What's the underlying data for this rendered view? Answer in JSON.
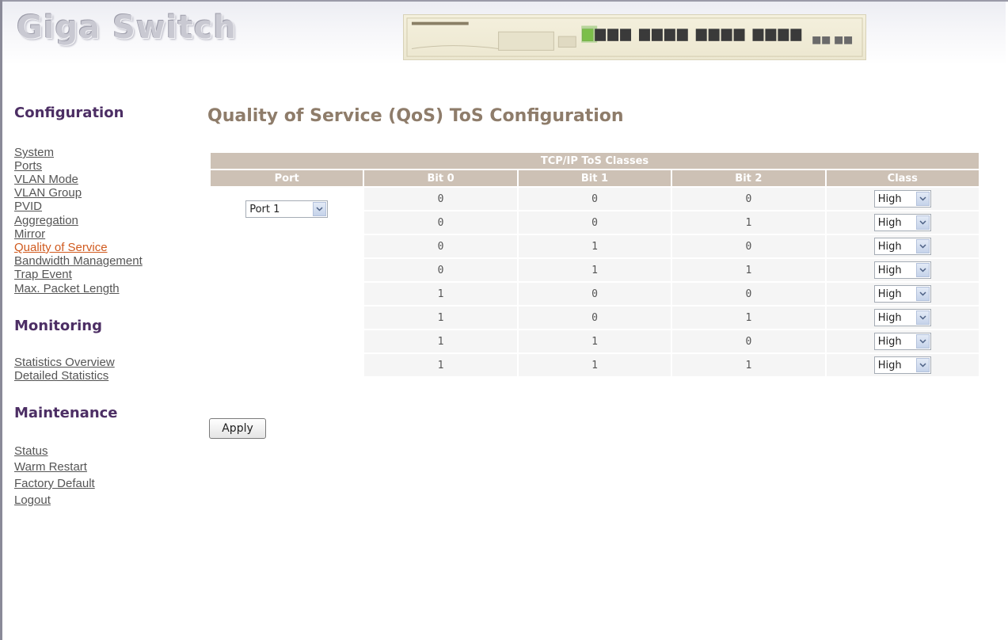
{
  "header": {
    "logo_text": "Giga Switch"
  },
  "sidebar": {
    "configuration": {
      "heading": "Configuration",
      "items": [
        {
          "label": "System"
        },
        {
          "label": "Ports"
        },
        {
          "label": "VLAN Mode"
        },
        {
          "label": "VLAN Group"
        },
        {
          "label": "PVID"
        },
        {
          "label": "Aggregation"
        },
        {
          "label": "Mirror"
        },
        {
          "label": "Quality of Service",
          "active": true
        },
        {
          "label": "Bandwidth Management"
        },
        {
          "label": "Trap Event"
        },
        {
          "label": "Max. Packet Length"
        }
      ]
    },
    "monitoring": {
      "heading": "Monitoring",
      "items": [
        {
          "label": "Statistics Overview"
        },
        {
          "label": "Detailed Statistics"
        }
      ]
    },
    "maintenance": {
      "heading": "Maintenance",
      "items": [
        {
          "label": "Status"
        },
        {
          "label": "Warm Restart"
        },
        {
          "label": "Factory Default"
        },
        {
          "label": "Logout"
        }
      ]
    }
  },
  "main": {
    "title": "Quality of Service (QoS) ToS Configuration",
    "table": {
      "caption": "TCP/IP ToS Classes",
      "columns": [
        "Port",
        "Bit 0",
        "Bit 1",
        "Bit 2",
        "Class"
      ],
      "port_value": "Port 1",
      "rows": [
        {
          "bit0": "0",
          "bit1": "0",
          "bit2": "0",
          "class": "High"
        },
        {
          "bit0": "0",
          "bit1": "0",
          "bit2": "1",
          "class": "High"
        },
        {
          "bit0": "0",
          "bit1": "1",
          "bit2": "0",
          "class": "High"
        },
        {
          "bit0": "0",
          "bit1": "1",
          "bit2": "1",
          "class": "High"
        },
        {
          "bit0": "1",
          "bit1": "0",
          "bit2": "0",
          "class": "High"
        },
        {
          "bit0": "1",
          "bit1": "0",
          "bit2": "1",
          "class": "High"
        },
        {
          "bit0": "1",
          "bit1": "1",
          "bit2": "0",
          "class": "High"
        },
        {
          "bit0": "1",
          "bit1": "1",
          "bit2": "1",
          "class": "High"
        }
      ]
    },
    "apply_label": "Apply"
  },
  "colors": {
    "header_bg": "#cdc1b5",
    "active_link": "#d05a1e",
    "heading": "#4c2e64",
    "title": "#8e7c6a"
  },
  "icons": {
    "dropdown": "chevron-down-icon",
    "switch": "switch-front-panel-image"
  }
}
